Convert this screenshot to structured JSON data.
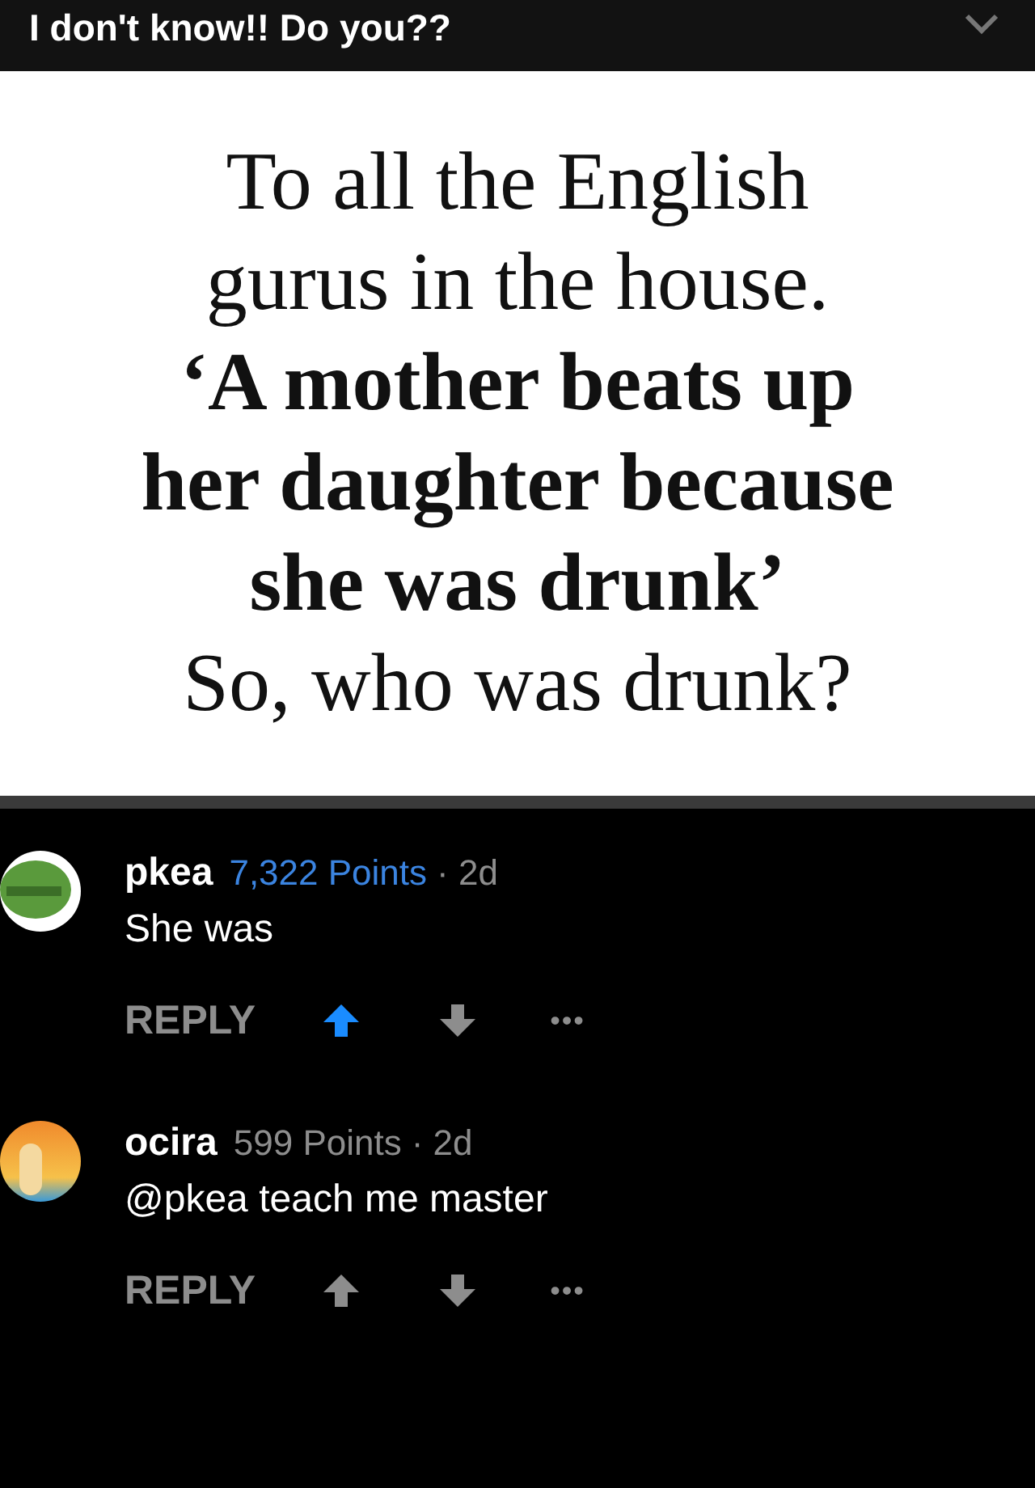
{
  "header": {
    "title": "I don't know!! Do you??"
  },
  "post_image": {
    "lines": [
      {
        "text": "To all the English",
        "bold": false
      },
      {
        "text": "gurus in the house.",
        "bold": false
      },
      {
        "text": "‘A mother beats up",
        "bold": true
      },
      {
        "text": "her daughter because",
        "bold": true
      },
      {
        "text": "she was drunk’",
        "bold": true
      },
      {
        "text": "So, who was drunk?",
        "bold": false
      }
    ]
  },
  "comments": [
    {
      "username": "pkea",
      "points": "7,322 Points",
      "time": "· 2d",
      "body": "She was",
      "reply": "REPLY",
      "upvoted": true,
      "downvoted": false,
      "more": "•••",
      "kind": "frog"
    },
    {
      "username": "ocira",
      "points": "599 Points",
      "time": "· 2d",
      "body": "@pkea teach me master",
      "reply": "REPLY",
      "upvoted": false,
      "downvoted": false,
      "more": "•••",
      "kind": "sunset"
    }
  ]
}
